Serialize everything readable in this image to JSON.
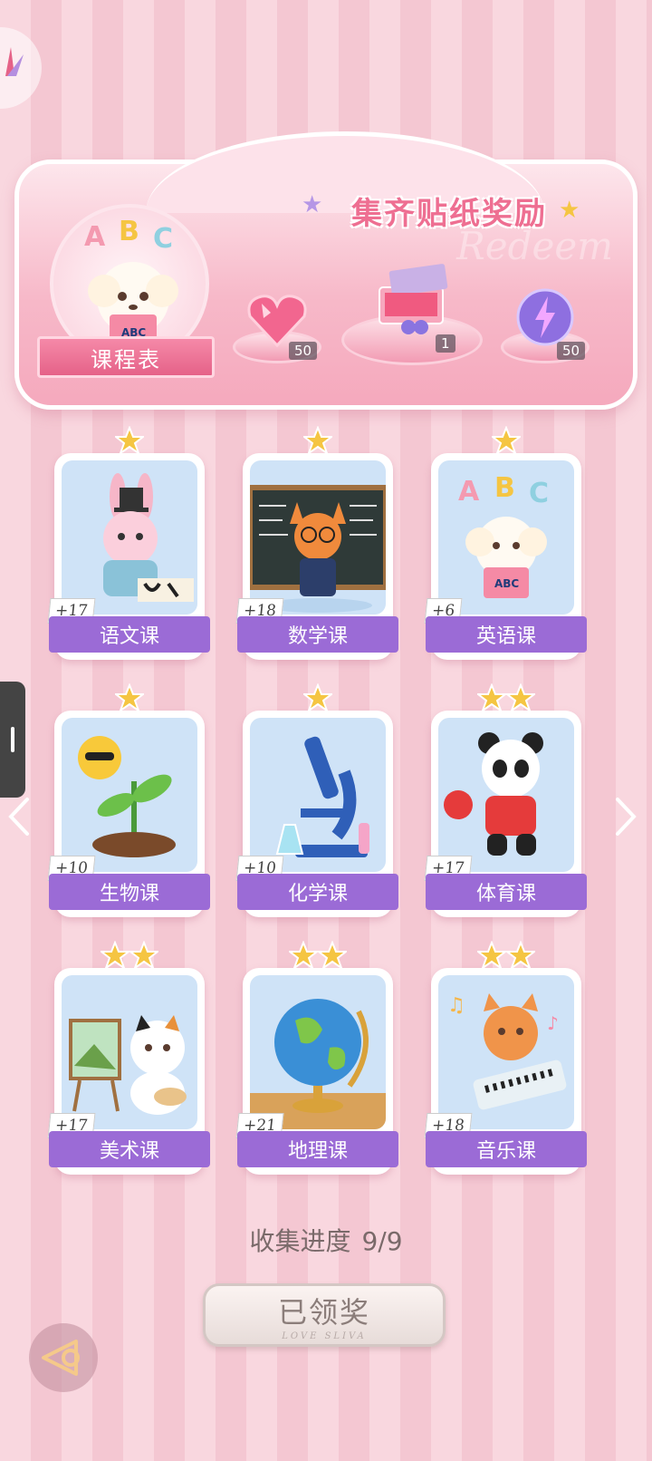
{
  "banner": {
    "title": "集齐贴纸奖励",
    "watermark": "Redeem",
    "schedule_label": "课程表",
    "rewards": [
      {
        "icon": "heart-gem-icon",
        "count": "50"
      },
      {
        "icon": "gift-box-icon",
        "count": "1"
      },
      {
        "icon": "energy-orb-icon",
        "count": "50"
      }
    ]
  },
  "cards": [
    {
      "label": "语文课",
      "count": "+17",
      "stars": 1,
      "icon": "bunny-calligraphy-icon"
    },
    {
      "label": "数学课",
      "count": "+18",
      "stars": 1,
      "icon": "fox-teacher-icon"
    },
    {
      "label": "英语课",
      "count": "+6",
      "stars": 1,
      "icon": "puppy-abc-icon"
    },
    {
      "label": "生物课",
      "count": "+10",
      "stars": 1,
      "icon": "sprout-sun-icon"
    },
    {
      "label": "化学课",
      "count": "+10",
      "stars": 1,
      "icon": "microscope-icon"
    },
    {
      "label": "体育课",
      "count": "+17",
      "stars": 2,
      "icon": "panda-pingpong-icon"
    },
    {
      "label": "美术课",
      "count": "+17",
      "stars": 2,
      "icon": "cat-painter-icon"
    },
    {
      "label": "地理课",
      "count": "+21",
      "stars": 2,
      "icon": "globe-icon"
    },
    {
      "label": "音乐课",
      "count": "+18",
      "stars": 2,
      "icon": "cat-keyboard-icon"
    }
  ],
  "progress": {
    "label": "收集进度",
    "value": "9/9"
  },
  "claim_button": {
    "label": "已领奖",
    "sub": "LOVE SLIVA"
  },
  "colors": {
    "accent": "#ee6f92",
    "label_bg": "#9b6bd6",
    "star": "#f5c542"
  }
}
